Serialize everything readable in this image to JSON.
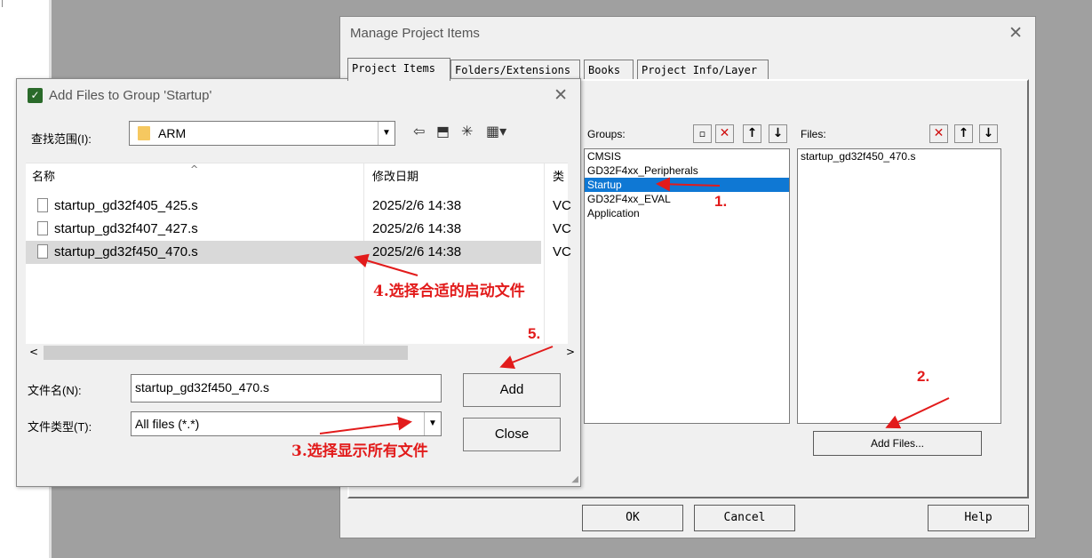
{
  "manage_dialog": {
    "title": "Manage Project Items",
    "close": "✕",
    "tabs": [
      "Project Items",
      "Folders/Extensions",
      "Books",
      "Project Info/Layer"
    ],
    "groups_label": "Groups:",
    "files_label": "Files:",
    "groups": [
      "CMSIS",
      "GD32F4xx_Peripherals",
      "Startup",
      "GD32F4xx_EVAL",
      "Application"
    ],
    "selected_group": "Startup",
    "files": [
      "startup_gd32f450_470.s"
    ],
    "add_files_button": "Add Files...",
    "ok_button": "OK",
    "cancel_button": "Cancel",
    "help_button": "Help"
  },
  "add_dialog": {
    "title": "Add Files to Group 'Startup'",
    "close": "✕",
    "look_in_label": "查找范围(I):",
    "look_in_value": "ARM",
    "columns": {
      "name": "名称",
      "date": "修改日期",
      "type": "类"
    },
    "files": [
      {
        "name": "startup_gd32f405_425.s",
        "date": "2025/2/6 14:38",
        "type": "VC"
      },
      {
        "name": "startup_gd32f407_427.s",
        "date": "2025/2/6 14:38",
        "type": "VC"
      },
      {
        "name": "startup_gd32f450_470.s",
        "date": "2025/2/6 14:38",
        "type": "VC"
      }
    ],
    "filename_label": "文件名(N):",
    "filename_value": "startup_gd32f450_470.s",
    "filetype_label": "文件类型(T):",
    "filetype_value": "All files (*.*)",
    "add_button": "Add",
    "close_button": "Close"
  },
  "annotations": {
    "step1": "1.",
    "step2": "2.",
    "step3": "3.选择显示所有文件",
    "step4": "4.选择合适的启动文件",
    "step5": "5."
  },
  "colors": {
    "annotation": "#e21b1b",
    "selection": "#0f78d4"
  }
}
